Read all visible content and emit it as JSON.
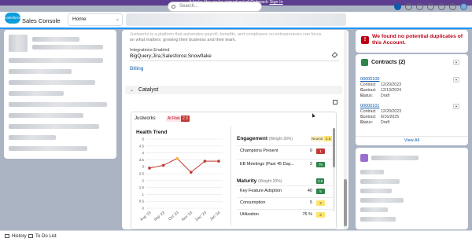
{
  "banner": {
    "text": "It looks like you're signed out of Outreach",
    "link": "Sign In"
  },
  "search": {
    "placeholder": "Search..."
  },
  "app": {
    "logo": "salesforce",
    "name": "Sales Console"
  },
  "tabs": {
    "home": "Home"
  },
  "center": {
    "about_text_1": "Justworks is a platform that automates payroll, benefits, and compliance so entrepreneurs can focus",
    "about_text_2": "on what matters: growing their business and their team.",
    "integrations_label": "Integrations Enabled",
    "integrations_value": "BigQuery;Jira;Salesforce;Snowflake",
    "billing_label": "Billing",
    "catalyst_label": "Catalyst"
  },
  "catalyst": {
    "company": "Justworks",
    "status": "At Risk",
    "score": "2.3",
    "health_trend_title": "Health Trend",
    "engagement": {
      "title": "Engagement",
      "weight": "(Weight 30%)",
      "status": "Neutral",
      "score": "2.5",
      "rows": [
        {
          "name": "Champions Present",
          "value": "0",
          "score": "1",
          "color": "red"
        },
        {
          "name": "EB Meetings (Past 45 Day...",
          "value": "2",
          "score": "70",
          "color": "green"
        }
      ]
    },
    "maturity": {
      "title": "Maturity",
      "weight": "(Weight 20%)",
      "score": "3.8",
      "rows": [
        {
          "name": "Key Feature Adoption",
          "value": "40",
          "score": "5",
          "color": "green"
        },
        {
          "name": "Consumption",
          "value": "5",
          "score": "3",
          "color": "yellow"
        },
        {
          "name": "Utilization",
          "value": "76 %",
          "score": "3",
          "color": "yellow"
        }
      ]
    }
  },
  "chart_data": {
    "type": "line",
    "title": "Health Trend",
    "categories": [
      "Aug '23",
      "Sep '23",
      "Oct '23",
      "Nov '23",
      "Dec '23",
      "Jan '24"
    ],
    "y_ticks": [
      "0",
      "0.5",
      "1",
      "1.5",
      "2",
      "2.5",
      "3",
      "3.5",
      "4",
      "4.5",
      "5"
    ],
    "ylim": [
      0,
      5
    ],
    "series": [
      {
        "values": [
          2.9,
          3.1,
          3.6,
          2.6,
          3.4,
          3.4
        ],
        "color": "#c23934",
        "highlight_index": 2,
        "highlight_color": "#f4bc25"
      }
    ],
    "grid": true
  },
  "duplicates": {
    "message": "We found no potential duplicates of this Account."
  },
  "contracts": {
    "title": "Contracts (2)",
    "records": [
      {
        "number": "00000100",
        "start": "12/20/2023",
        "end": "12/19/2024",
        "status": "Draft"
      },
      {
        "number": "00000101",
        "start": "12/20/2023",
        "end": "6/16/2025",
        "status": "Draft"
      }
    ],
    "labels": {
      "start": "Contract S...",
      "end": "Contract E...",
      "status": "Status:"
    },
    "view_all": "View All"
  },
  "footer": {
    "history": "History",
    "todo": "To Do List"
  },
  "colors": {
    "brand": "#1b96ff",
    "link": "#0b5cab",
    "risk": "#c23934",
    "banner": "#5c3d8f"
  }
}
